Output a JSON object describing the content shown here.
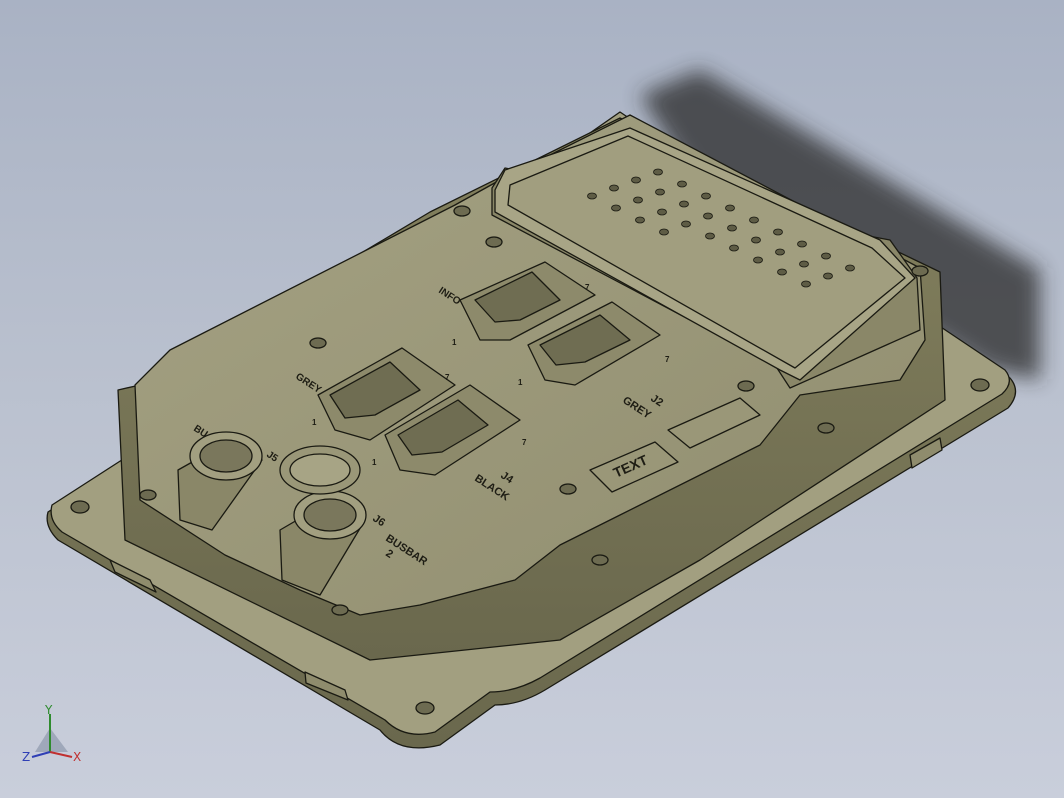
{
  "model": {
    "connector_labels": {
      "j2": "J2",
      "j2_color": "GREY",
      "j4": "J4",
      "j4_color": "BLACK",
      "j6": "J6",
      "busbar": "BUSBAR",
      "busbar_num": "2",
      "grey_partial": "GREY",
      "info_partial": "INFO",
      "bu_partial": "BU",
      "j5": "J5"
    },
    "pin_markers": [
      "1",
      "7",
      "1",
      "7",
      "1",
      "7",
      "1",
      "7"
    ],
    "logo_text": "TEXT"
  },
  "triad": {
    "y": "Y",
    "z": "Z",
    "x": "X"
  },
  "colors": {
    "body_light": "#9d9a7b",
    "body_mid": "#7f7c60",
    "body_dark": "#5c5a44",
    "edge": "#1a1a12",
    "shadow": "#2c2c2c"
  }
}
